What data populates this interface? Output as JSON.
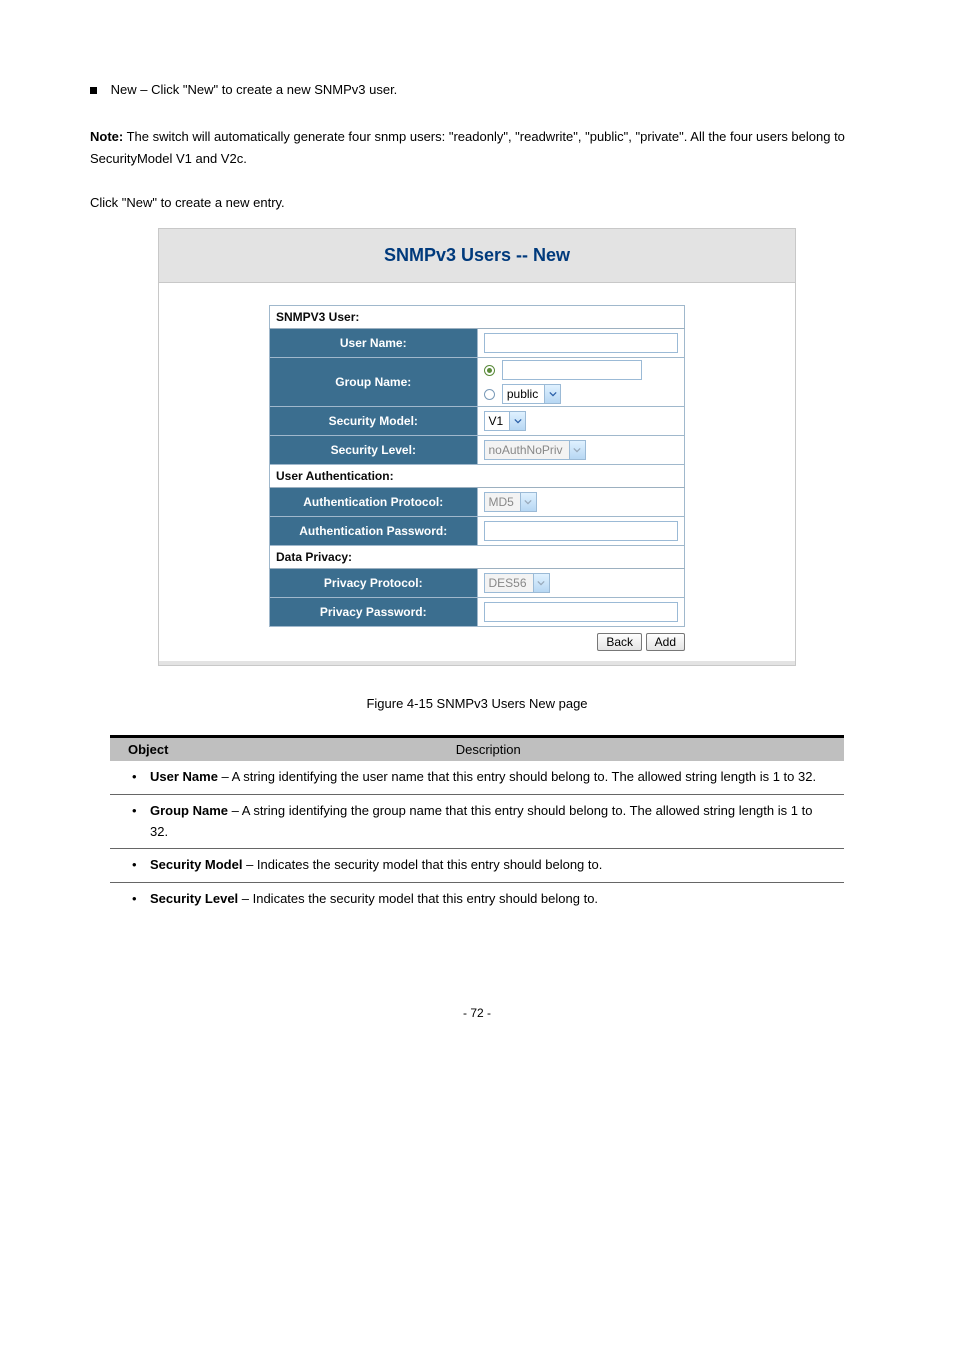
{
  "intro": {
    "bullet_text": "New – Click \"New\" to create a new SNMPv3 user."
  },
  "note": {
    "label": "Note:",
    "text": "The switch will automatically generate four snmp users: \"readonly\", \"readwrite\", \"public\", \"private\". All the four users belong to SecurityModel V1 and V2c."
  },
  "click_new_text": "Click \"New\" to create a new entry.",
  "screenshot": {
    "title": "SNMPv3 Users -- New",
    "sections": {
      "user": "SNMPV3 User:",
      "auth": "User Authentication:",
      "priv": "Data Privacy:"
    },
    "labels": {
      "user_name": "User Name:",
      "group_name": "Group Name:",
      "security_model": "Security Model:",
      "security_level": "Security Level:",
      "auth_protocol": "Authentication Protocol:",
      "auth_password": "Authentication Password:",
      "priv_protocol": "Privacy Protocol:",
      "priv_password": "Privacy Password:"
    },
    "values": {
      "group_dropdown": "public",
      "security_model": "V1",
      "security_level": "noAuthNoPriv",
      "auth_protocol": "MD5",
      "priv_protocol": "DES56"
    },
    "buttons": {
      "back": "Back",
      "add": "Add"
    }
  },
  "figure_caption": "Figure 4-15 SNMPv3 Users New page",
  "desc_table": {
    "header_object": "Object",
    "header_description": "Description",
    "rows": [
      {
        "object": "User Name",
        "desc": " – A string identifying the user name that this entry should belong to. The allowed string length is 1 to 32."
      },
      {
        "object": "Group Name",
        "desc": " – A string identifying the group name that this entry should belong to. The allowed string length is 1 to 32."
      },
      {
        "object": "Security Model",
        "desc": " – Indicates the security model that this entry should belong to."
      },
      {
        "object": "Security Level",
        "desc": " – Indicates the security model that this entry should belong to."
      }
    ]
  },
  "footer": "- 72 -"
}
